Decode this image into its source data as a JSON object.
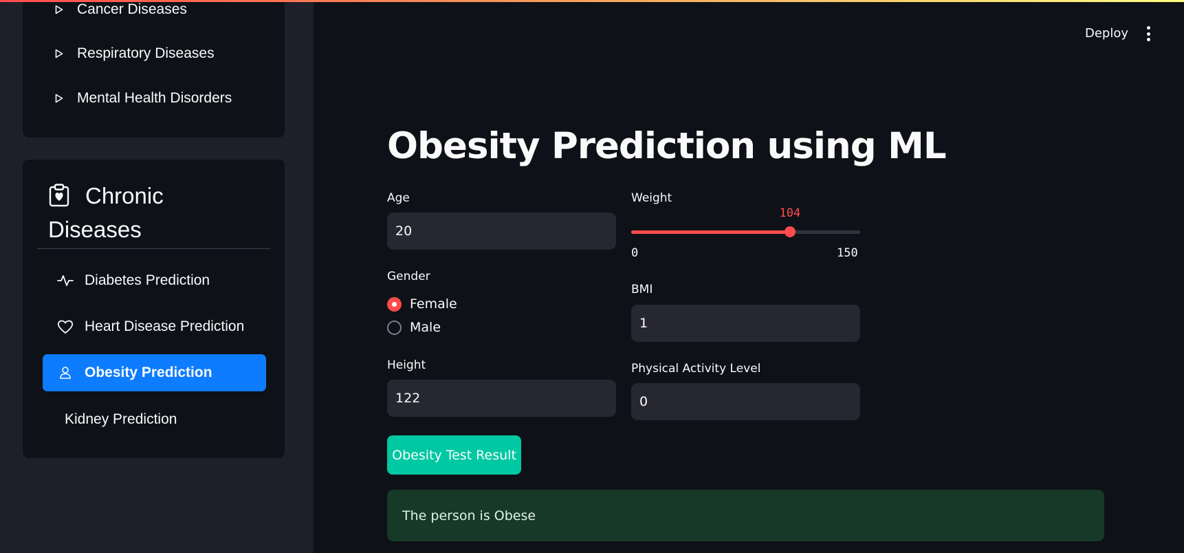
{
  "sidebar": {
    "categories": [
      {
        "label": "Cancer Diseases",
        "icon": "caret-right-icon"
      },
      {
        "label": "Respiratory Diseases",
        "icon": "caret-right-icon"
      },
      {
        "label": "Mental Health Disorders",
        "icon": "caret-right-icon"
      }
    ],
    "section": {
      "title_line1": "Chronic",
      "title_line2": "Diseases",
      "icon": "clipboard-heart-icon"
    },
    "items": [
      {
        "label": "Diabetes Prediction",
        "icon": "activity-icon",
        "active": false
      },
      {
        "label": "Heart Disease Prediction",
        "icon": "heart-icon",
        "active": false
      },
      {
        "label": "Obesity Prediction",
        "icon": "person-icon",
        "active": true
      },
      {
        "label": "Kidney Prediction",
        "icon": "",
        "active": false
      }
    ]
  },
  "header": {
    "deploy_label": "Deploy",
    "menu_icon": "more-vertical-icon"
  },
  "main": {
    "title": "Obesity Prediction using ML",
    "age": {
      "label": "Age",
      "value": "20"
    },
    "gender": {
      "label": "Gender",
      "options": [
        "Female",
        "Male"
      ],
      "selected": "Female"
    },
    "height": {
      "label": "Height",
      "value": "122"
    },
    "weight": {
      "label": "Weight",
      "value": 104,
      "min": 0,
      "max": 150,
      "value_text": "104",
      "min_text": "0",
      "max_text": "150"
    },
    "bmi": {
      "label": "BMI",
      "value": "1"
    },
    "activity": {
      "label": "Physical Activity Level",
      "value": "0"
    },
    "submit_label": "Obesity Test Result",
    "result": "The person is Obese"
  },
  "colors": {
    "accent": "#ff4b4b",
    "active_nav": "#0d7cfe",
    "button": "#00c8a3",
    "success_bg": "#173928"
  }
}
